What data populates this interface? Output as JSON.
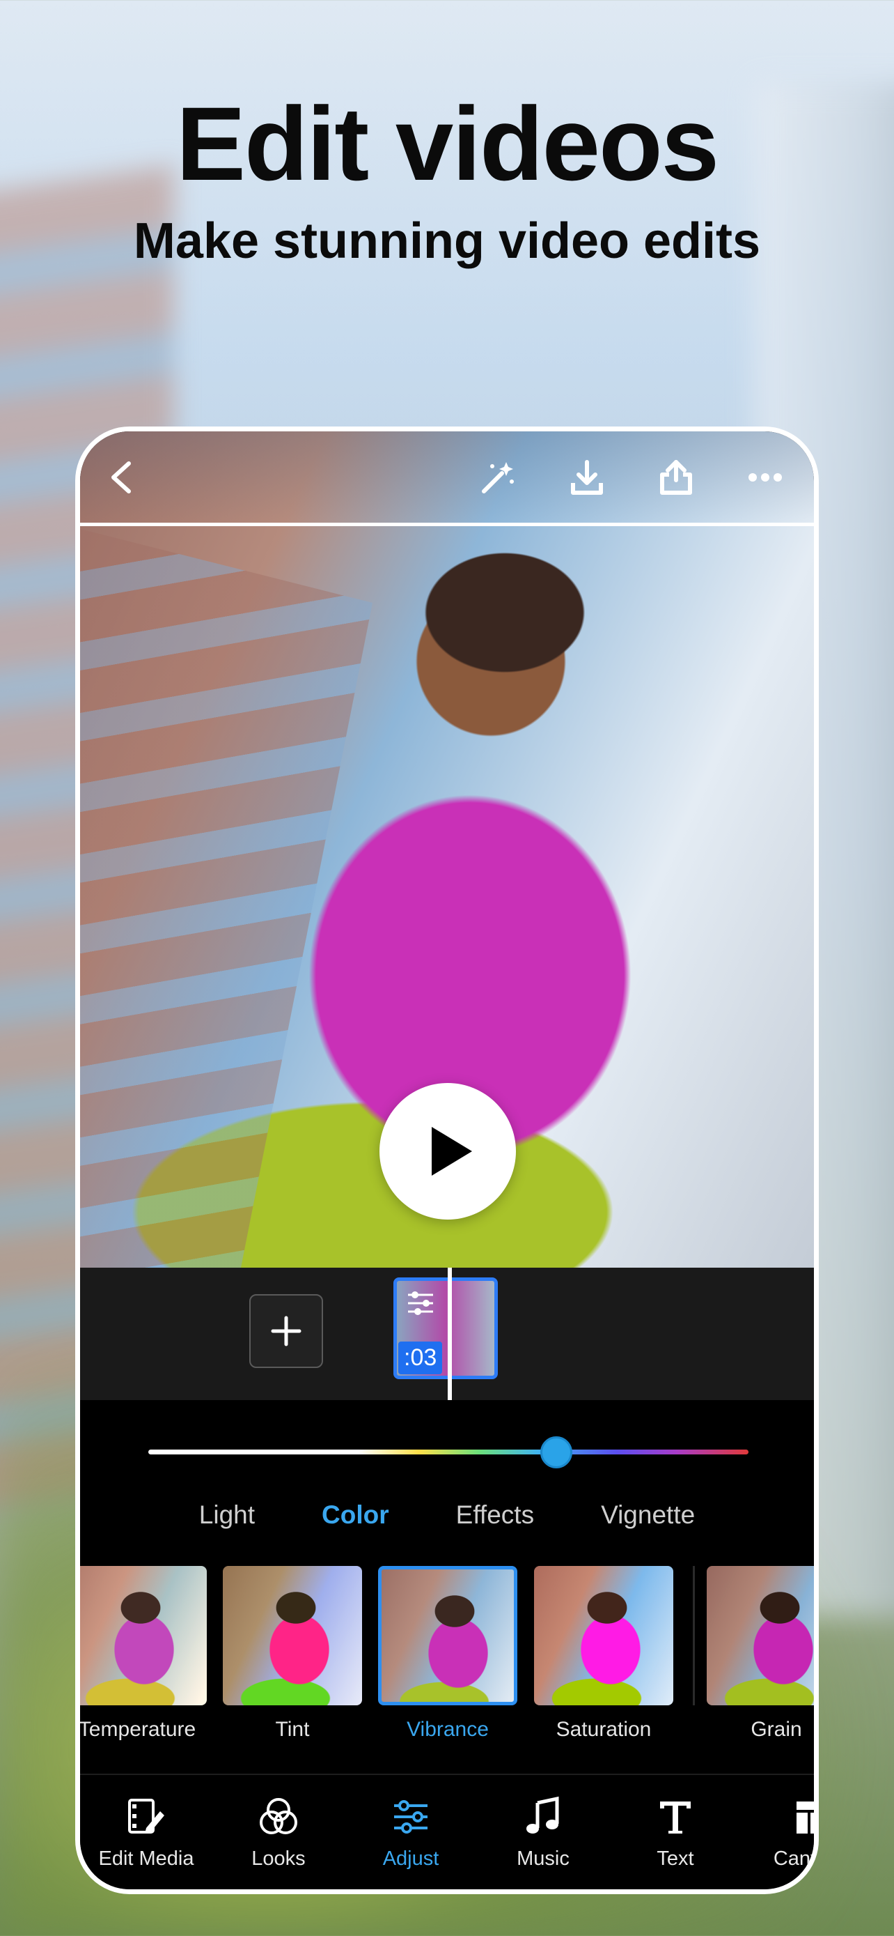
{
  "headline": {
    "title": "Edit videos",
    "subtitle": "Make stunning video edits"
  },
  "top_bar": {
    "icons": [
      "back-icon",
      "magic-wand-icon",
      "download-icon",
      "share-icon",
      "more-icon"
    ]
  },
  "timeline": {
    "clip_duration": ":03"
  },
  "adjust": {
    "slider_value": 0.68,
    "tabs": [
      {
        "label": "Light",
        "active": false
      },
      {
        "label": "Color",
        "active": true
      },
      {
        "label": "Effects",
        "active": false
      },
      {
        "label": "Vignette",
        "active": false
      }
    ],
    "presets": [
      {
        "label": "Temperature",
        "selected": false
      },
      {
        "label": "Tint",
        "selected": false
      },
      {
        "label": "Vibrance",
        "selected": true
      },
      {
        "label": "Saturation",
        "selected": false
      },
      {
        "label": "Grain",
        "selected": false
      }
    ]
  },
  "bottom_nav": [
    {
      "label": "Edit Media",
      "icon": "film-edit-icon",
      "active": false
    },
    {
      "label": "Looks",
      "icon": "looks-circles-icon",
      "active": false
    },
    {
      "label": "Adjust",
      "icon": "sliders-icon",
      "active": true
    },
    {
      "label": "Music",
      "icon": "music-note-icon",
      "active": false
    },
    {
      "label": "Text",
      "icon": "text-icon",
      "active": false
    },
    {
      "label": "Canvas",
      "icon": "canvas-icon",
      "active": false
    }
  ],
  "colors": {
    "accent": "#3aa7ef",
    "clip_border": "#2d7cf6",
    "panel_bg": "#000000",
    "timeline_bg": "#1a1a1a"
  }
}
